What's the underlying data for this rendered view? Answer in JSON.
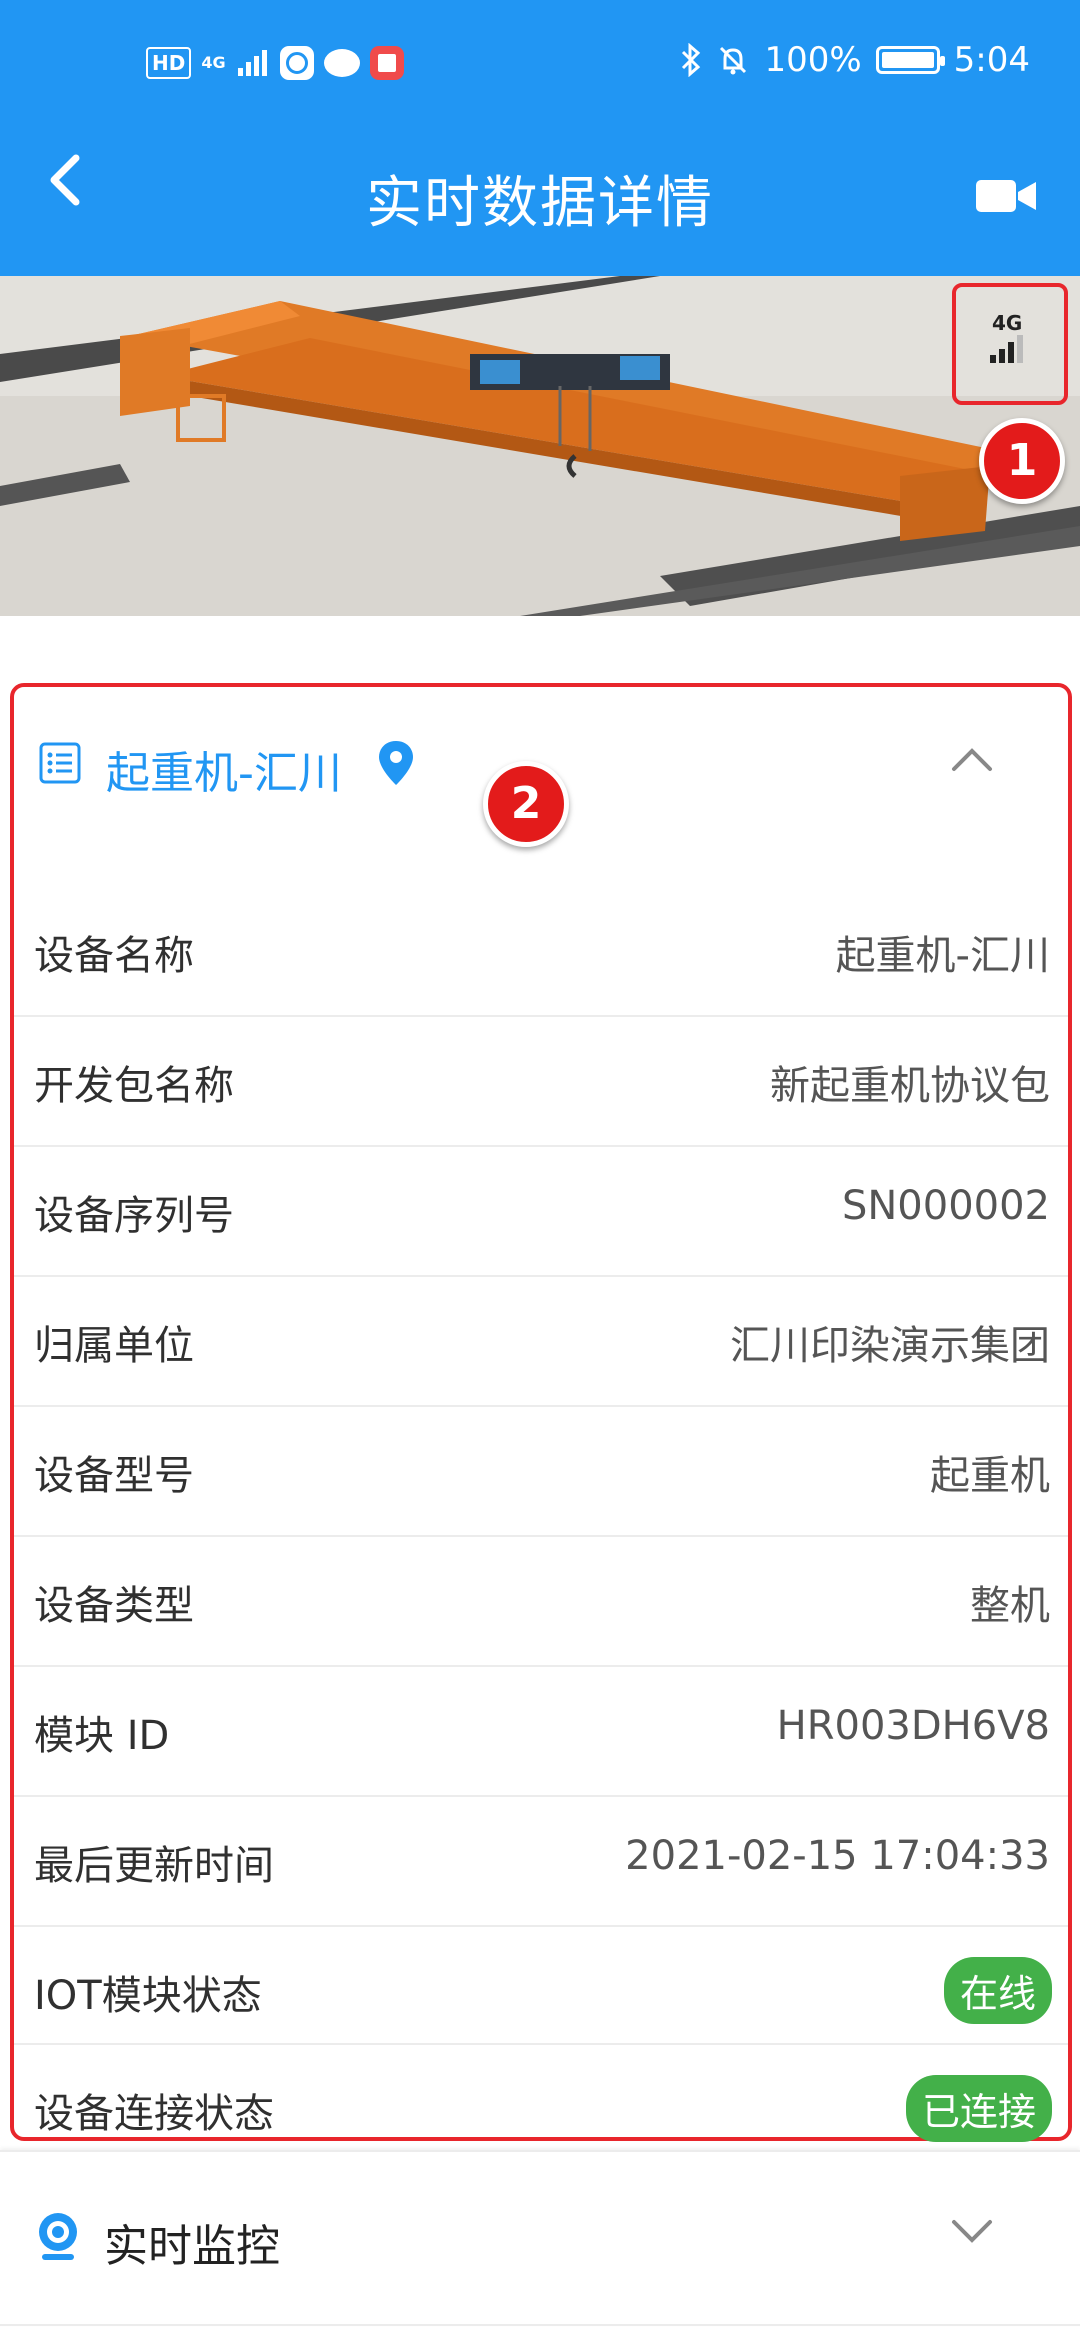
{
  "status_bar": {
    "hd": "HD",
    "network": "4G",
    "battery": "100%",
    "time": "5:04"
  },
  "header": {
    "title": "实时数据详情"
  },
  "hero": {
    "signal_label": "4G",
    "annotation_1": "1",
    "annotation_2": "2"
  },
  "device_card": {
    "title": "起重机-汇川",
    "rows": [
      {
        "label": "设备名称",
        "value": "起重机-汇川"
      },
      {
        "label": "开发包名称",
        "value": "新起重机协议包"
      },
      {
        "label": "设备序列号",
        "value": "SN000002"
      },
      {
        "label": "归属单位",
        "value": "汇川印染演示集团"
      },
      {
        "label": "设备型号",
        "value": "起重机"
      },
      {
        "label": "设备类型",
        "value": "整机"
      },
      {
        "label": "模块 ID",
        "value": "HR003DH6V8"
      },
      {
        "label": "最后更新时间",
        "value": "2021-02-15 17:04:33"
      },
      {
        "label": "IOT模块状态",
        "value": "在线"
      },
      {
        "label": "设备连接状态",
        "value": "已连接"
      }
    ]
  },
  "monitor_section": {
    "title": "实时监控"
  },
  "colors": {
    "primary": "#2196f3",
    "annotation_red": "#e8262c",
    "status_green": "#43b049"
  }
}
